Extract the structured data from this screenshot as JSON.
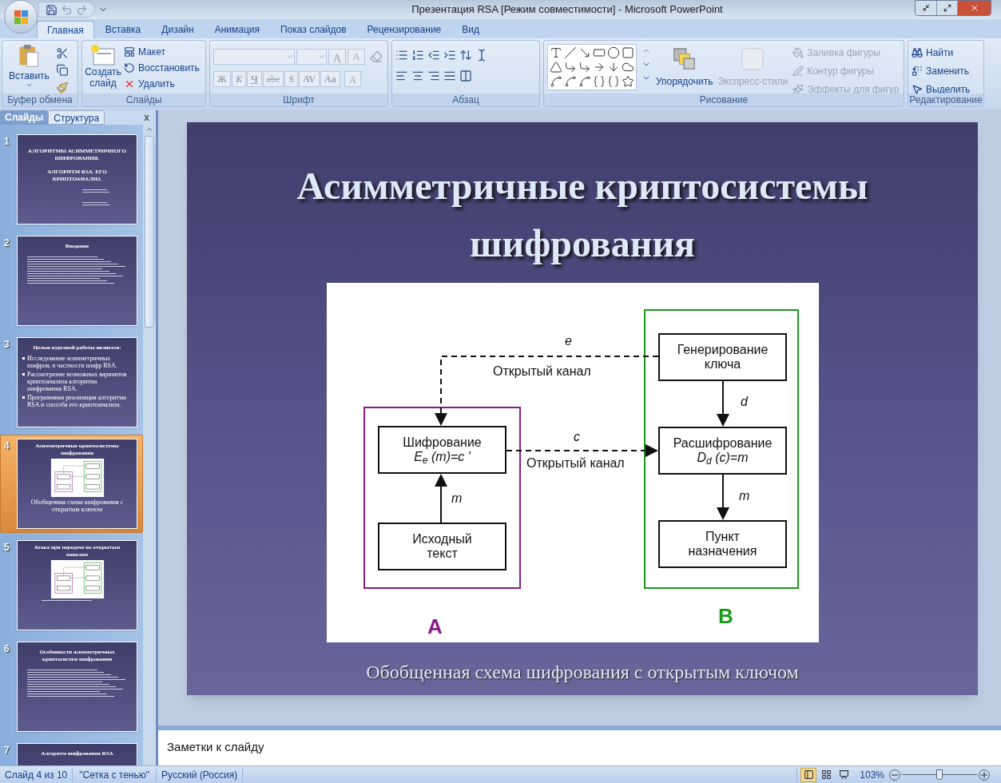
{
  "window": {
    "title": "Презентация RSA [Режим совместимости] - Microsoft PowerPoint"
  },
  "ribbon_tabs": [
    {
      "label": "Главная",
      "selected": true
    },
    {
      "label": "Вставка",
      "selected": false
    },
    {
      "label": "Дизайн",
      "selected": false
    },
    {
      "label": "Анимация",
      "selected": false
    },
    {
      "label": "Показ слайдов",
      "selected": false
    },
    {
      "label": "Рецензирование",
      "selected": false
    },
    {
      "label": "Вид",
      "selected": false
    }
  ],
  "clipboard": {
    "label": "Буфер обмена",
    "paste": "Вставить"
  },
  "slides_group": {
    "label": "Слайды",
    "new_slide": "Создать слайд",
    "commands": [
      "Макет",
      "Восстановить",
      "Удалить"
    ]
  },
  "font_group": {
    "label": "Шрифт",
    "disabled": true,
    "size_buttons": [
      "A",
      "A"
    ],
    "format_buttons": [
      "Ж",
      "К",
      "Ч",
      "abc",
      "S",
      "AV",
      "Aa"
    ],
    "color_button": "A"
  },
  "paragraph_group": {
    "label": "Абзац"
  },
  "drawing_group": {
    "label": "Рисование",
    "arrange": "Упорядочить",
    "quick_styles": {
      "label": "Экспресс-стили",
      "disabled": true
    },
    "commands": [
      {
        "label": "Заливка фигуры",
        "disabled": true
      },
      {
        "label": "Контур фигуры",
        "disabled": true
      },
      {
        "label": "Эффекты для фигур",
        "disabled": true
      }
    ]
  },
  "editing_group": {
    "label": "Редактирование",
    "commands": [
      "Найти",
      "Заменить",
      "Выделить"
    ]
  },
  "panel_tabs": [
    {
      "label": "Слайды",
      "selected": true
    },
    {
      "label": "Структура",
      "selected": false
    }
  ],
  "panel_close": "x",
  "thumbnails": [
    {
      "number": "1",
      "kind": "title",
      "selected": false,
      "lines": [
        "АЛГОРИТМЫ АСИММЕТРИЧНОГО ШИФРОВАНИЯ.",
        "АЛГОРИТМ RSA. ЕГО КРИПТОАНАЛИЗ."
      ]
    },
    {
      "number": "2",
      "kind": "text",
      "selected": false,
      "title": "Введение"
    },
    {
      "number": "3",
      "kind": "bullets",
      "selected": false,
      "title": "Целью курсовой работы является:",
      "bullets": [
        "Исследование асимметричных шифров, в частности шифр RSA.",
        "Рассмотрение возможных вариантов криптоанализа алгоритма шифрования RSA.",
        "Программная реализация алгоритма RSA и способа его криптоанализа."
      ]
    },
    {
      "number": "4",
      "kind": "diagram",
      "selected": true,
      "title": "Асимметричные криптосистемы шифрования",
      "caption": "Обобщенная схема шифрования с открытым ключом"
    },
    {
      "number": "5",
      "kind": "diagram",
      "selected": false,
      "title": "Атака при передаче по открытым каналам"
    },
    {
      "number": "6",
      "kind": "text",
      "selected": false,
      "title": "Особенности асимметричных криптосистем шифрования"
    },
    {
      "number": "7",
      "kind": "text",
      "selected": false,
      "title": "Алгоритм шифрования RSA"
    }
  ],
  "slide": {
    "title": "Асимметричные криптосистемы шифрования",
    "caption": "Обобщенная схема шифрования с открытым ключом",
    "diagram": {
      "parties": [
        {
          "label": "A",
          "color": "#8a1a8a"
        },
        {
          "label": "B",
          "color": "#1a9a1a"
        }
      ],
      "nodes": [
        {
          "lines": [
            "Шифрование",
            "E$_{e}$ (m)=c '"
          ]
        },
        {
          "lines": [
            "Исходный",
            "текст"
          ]
        },
        {
          "lines": [
            "Генерирование",
            "ключа"
          ]
        },
        {
          "lines": [
            "Расшифрование",
            "D$_{d}$ (c)=m"
          ]
        },
        {
          "lines": [
            "Пункт",
            "назначения"
          ]
        }
      ],
      "labels": [
        "e",
        "Открытый канал",
        "c",
        "Открытый канал",
        "d",
        "m",
        "m"
      ]
    }
  },
  "notes": {
    "placeholder": "Заметки к слайду"
  },
  "status_bar": {
    "slide": "Слайд 4 из 10",
    "theme": "\"Сетка с тенью\"",
    "language": "Русский (Россия)",
    "zoom": "103%",
    "zoom_slider": {
      "level": 0.5
    },
    "view_buttons": [
      {
        "selected": true
      },
      {
        "selected": false
      },
      {
        "selected": false
      }
    ]
  }
}
